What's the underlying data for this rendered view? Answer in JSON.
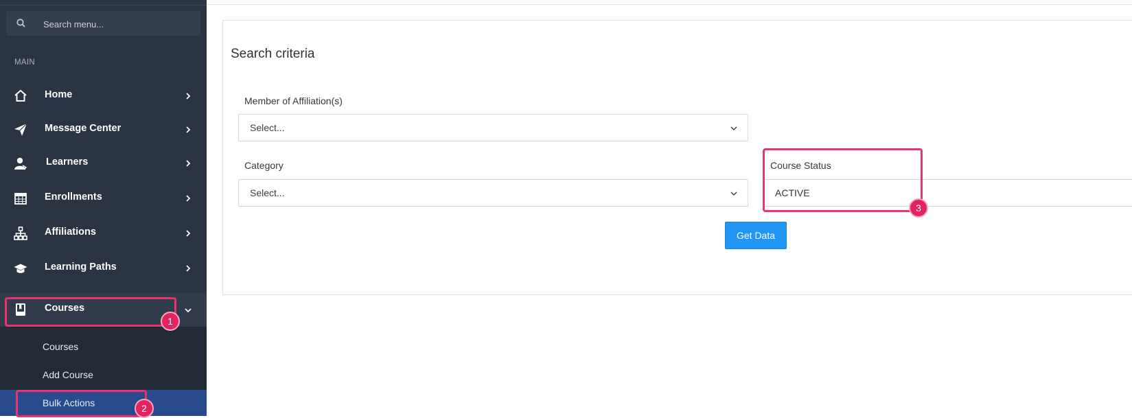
{
  "sidebar": {
    "search_placeholder": "Search menu...",
    "section_label": "MAIN",
    "items": [
      {
        "label": "Home",
        "icon": "home-icon"
      },
      {
        "label": "Message Center",
        "icon": "paper-plane-icon"
      },
      {
        "label": "Learners",
        "icon": "user-icon"
      },
      {
        "label": "Enrollments",
        "icon": "calendar-icon"
      },
      {
        "label": "Affiliations",
        "icon": "sitemap-icon"
      },
      {
        "label": "Learning Paths",
        "icon": "graduation-cap-icon"
      },
      {
        "label": "Courses",
        "icon": "book-icon",
        "expanded": true
      }
    ],
    "submenu": [
      {
        "label": "Courses"
      },
      {
        "label": "Add Course"
      },
      {
        "label": "Bulk Actions",
        "selected": true
      }
    ]
  },
  "main": {
    "card_title": "Search criteria",
    "fields": {
      "affiliation": {
        "label": "Member of Affiliation(s)",
        "value": "Select..."
      },
      "category": {
        "label": "Category",
        "value": "Select..."
      },
      "course_status": {
        "label": "Course Status",
        "value": "ACTIVE"
      }
    },
    "get_data_label": "Get Data"
  },
  "annotations": [
    {
      "number": "1"
    },
    {
      "number": "2"
    },
    {
      "number": "3"
    }
  ],
  "colors": {
    "sidebar_bg": "#2b3443",
    "selected_bg": "#2a4a8e",
    "button": "#2196f3",
    "highlight": "#e8336d"
  }
}
